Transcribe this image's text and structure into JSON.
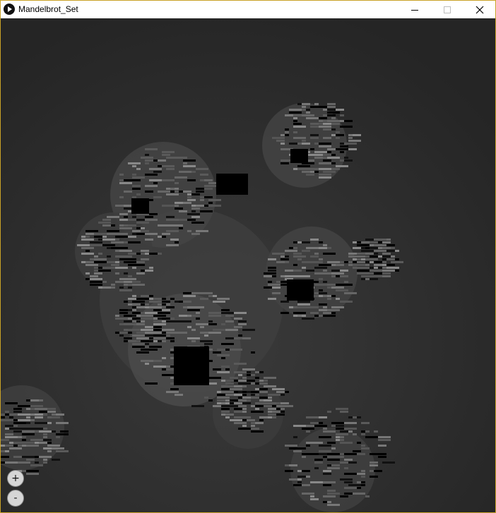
{
  "window": {
    "title": "Mandelbrot_Set"
  },
  "controls": {
    "zoom_in_label": "+",
    "zoom_out_label": "-"
  },
  "colors": {
    "frame": "#c9a227",
    "background": "#262626",
    "set_interior": "#000000"
  }
}
